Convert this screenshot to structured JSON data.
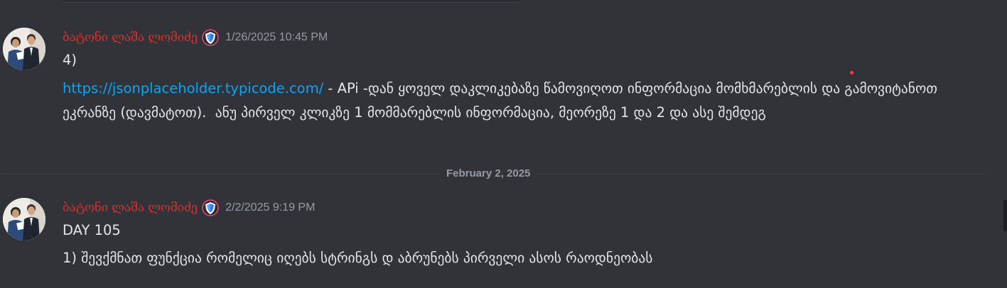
{
  "messages": [
    {
      "author": "ბატონი ლაშა ლომიძე",
      "badge_icon": "shield-badge-icon",
      "timestamp": "1/26/2025 10:45 PM",
      "line1": "4)",
      "link": "https://jsonplaceholder.typicode.com/",
      "body": " - APi -დან ყოველ დაკლიკებაზე წამოვიღოთ ინფორმაცია მომხმარებლის და გამოვიტანოთ ეკრანზე (დავმატოთ).  ანუ პირველ კლიკზე 1 მომმარებლის ინფორმაცია, მეორეზე 1 და 2 და ასე შემდეგ"
    },
    {
      "author": "ბატონი ლაშა ლომიძე",
      "badge_icon": "shield-badge-icon",
      "timestamp": "2/2/2025 9:19 PM",
      "line1": "DAY 105",
      "body": "1) შევქმნათ ფუნქცია რომელიც იღებს სტრინგს დ აბრუნებს პირველი ასოს რაოდნეობას"
    }
  ],
  "date_divider": "February 2, 2025",
  "colors": {
    "background": "#313338",
    "username": "#d62f2f",
    "link": "#00a8fc",
    "timestamp": "#949ba4"
  }
}
